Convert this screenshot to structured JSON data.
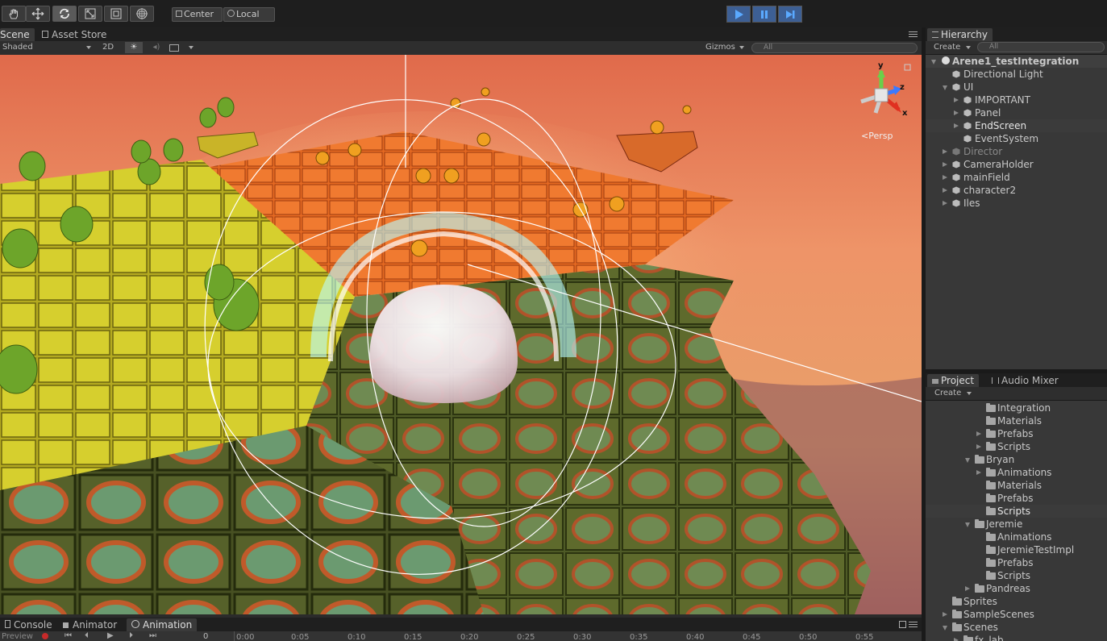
{
  "toolbar": {
    "tools": [
      "hand-tool-icon",
      "move-tool-icon",
      "rotate-tool-icon",
      "scale-tool-icon",
      "rect-tool-icon",
      "transform-tool-icon"
    ],
    "pivot_label": "Center",
    "space_label": "Local"
  },
  "scene_panel": {
    "tabs": [
      {
        "label": "Scene"
      },
      {
        "label": "Asset Store"
      }
    ],
    "shading_mode": "Shaded",
    "mode_2d": "2D",
    "gizmos_label": "Gizmos",
    "search_placeholder": "All",
    "persp_label": "Persp",
    "axis_y": "y",
    "axis_z": "z",
    "axis_x": "x"
  },
  "hierarchy": {
    "tab_label": "Hierarchy",
    "create_label": "Create",
    "search_placeholder": "All",
    "scene_name": "Arene1_testIntegration",
    "items": [
      {
        "label": "Directional Light"
      },
      {
        "label": "UI"
      },
      {
        "label": "IMPORTANT"
      },
      {
        "label": "Panel"
      },
      {
        "label": "EndScreen"
      },
      {
        "label": "EventSystem"
      },
      {
        "label": "Director"
      },
      {
        "label": "CameraHolder"
      },
      {
        "label": "mainField"
      },
      {
        "label": "character2"
      },
      {
        "label": "Iles"
      }
    ]
  },
  "project": {
    "tabs": [
      {
        "label": "Project"
      },
      {
        "label": "Audio Mixer"
      }
    ],
    "create_label": "Create",
    "items": [
      {
        "label": "Integration"
      },
      {
        "label": "Materials"
      },
      {
        "label": "Prefabs"
      },
      {
        "label": "Scripts"
      },
      {
        "label": "Bryan"
      },
      {
        "label": "Animations"
      },
      {
        "label": "Materials"
      },
      {
        "label": "Prefabs"
      },
      {
        "label": "Scripts"
      },
      {
        "label": "Jeremie"
      },
      {
        "label": "Animations"
      },
      {
        "label": "JeremieTestImpl"
      },
      {
        "label": "Prefabs"
      },
      {
        "label": "Scripts"
      },
      {
        "label": "Pandreas"
      },
      {
        "label": "Sprites"
      },
      {
        "label": "SampleScenes"
      },
      {
        "label": "Scenes"
      },
      {
        "label": "fx_lab"
      }
    ]
  },
  "bottom": {
    "tabs": [
      {
        "label": "Console"
      },
      {
        "label": "Animator"
      },
      {
        "label": "Animation"
      }
    ],
    "preview_label": "Preview",
    "frame_value": "0",
    "timeline_ticks": [
      "0:00",
      "0:05",
      "0:10",
      "0:15",
      "0:20",
      "0:25",
      "0:30",
      "0:35",
      "0:40",
      "0:45",
      "0:50",
      "0:55"
    ]
  }
}
